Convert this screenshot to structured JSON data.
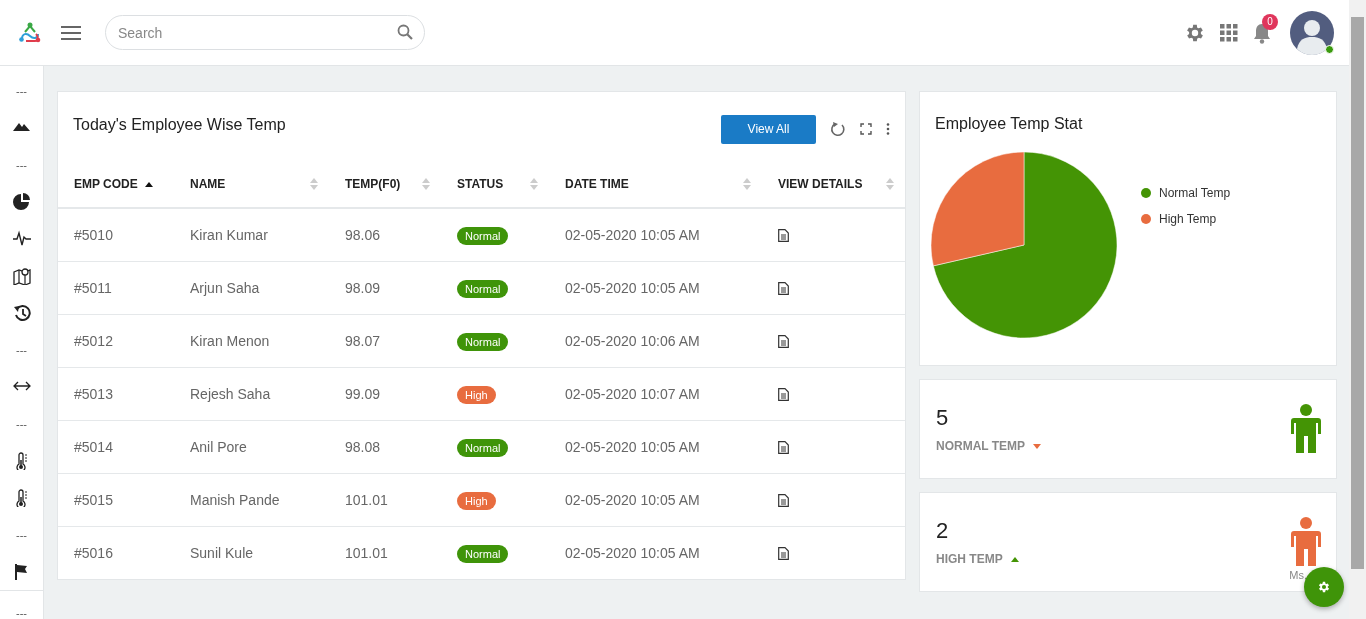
{
  "header": {
    "search": {
      "placeholder": "Search"
    },
    "notifications": {
      "count": "0"
    },
    "user": {
      "online": true
    }
  },
  "sidebar": {
    "items": [
      {
        "kind": "separator",
        "text": "---"
      },
      {
        "kind": "icon"
      },
      {
        "kind": "separator",
        "text": "---"
      },
      {
        "kind": "icon"
      },
      {
        "kind": "icon"
      },
      {
        "kind": "icon"
      },
      {
        "kind": "icon"
      },
      {
        "kind": "separator",
        "text": "---"
      },
      {
        "kind": "icon"
      },
      {
        "kind": "separator",
        "text": "---"
      },
      {
        "kind": "icon"
      },
      {
        "kind": "icon"
      },
      {
        "kind": "separator",
        "text": "---"
      },
      {
        "kind": "icon"
      }
    ],
    "footer": {
      "text": "---"
    }
  },
  "table_card": {
    "title": "Today's Employee Wise Temp",
    "button": "View All",
    "columns": [
      {
        "label": "EMP CODE",
        "sorted": true
      },
      {
        "label": "NAME",
        "sorted": false
      },
      {
        "label": "TEMP(F0)",
        "sorted": false
      },
      {
        "label": "STATUS",
        "sorted": false
      },
      {
        "label": "DATE TIME",
        "sorted": false
      },
      {
        "label": "VIEW DETAILS",
        "sorted": false
      }
    ],
    "rows": [
      {
        "code": "#5010",
        "name": "Kiran Kumar",
        "temp": "98.06",
        "status": {
          "text": "Normal",
          "color": "#3f9409"
        },
        "datetime": "02-05-2020 10:05 AM"
      },
      {
        "code": "#5011",
        "name": "Arjun Saha",
        "temp": "98.09",
        "status": {
          "text": "Normal",
          "color": "#3f9409"
        },
        "datetime": "02-05-2020 10:05 AM"
      },
      {
        "code": "#5012",
        "name": "Kiran Menon",
        "temp": "98.07",
        "status": {
          "text": "Normal",
          "color": "#3f9409"
        },
        "datetime": "02-05-2020 10:06 AM"
      },
      {
        "code": "#5013",
        "name": "Rejesh Saha",
        "temp": "99.09",
        "status": {
          "text": "High",
          "color": "#e86c3f"
        },
        "datetime": "02-05-2020 10:07 AM"
      },
      {
        "code": "#5014",
        "name": "Anil Pore",
        "temp": "98.08",
        "status": {
          "text": "Normal",
          "color": "#3f9409"
        },
        "datetime": "02-05-2020 10:05 AM"
      },
      {
        "code": "#5015",
        "name": "Manish Pande",
        "temp": "101.01",
        "status": {
          "text": "High",
          "color": "#e86c3f"
        },
        "datetime": "02-05-2020 10:05 AM"
      },
      {
        "code": "#5016",
        "name": "Sunil Kule",
        "temp": "101.01",
        "status": {
          "text": "Normal",
          "color": "#3f9409"
        },
        "datetime": "02-05-2020 10:05 AM"
      }
    ]
  },
  "pie_card": {
    "title": "Employee Temp Stat",
    "chart_data": {
      "type": "pie",
      "categories": [
        "Normal Temp",
        "High Temp"
      ],
      "values": [
        71.4,
        28.6
      ],
      "colors": [
        "#449405",
        "#e86c3f"
      ]
    }
  },
  "stat_cards": [
    {
      "value": "5",
      "label": "NORMAL TEMP",
      "trend_up": false,
      "color": "#449405"
    },
    {
      "value": "2",
      "label": "HIGH TEMP",
      "trend_up": true,
      "color": "#e86c3f",
      "caption": "Ms."
    }
  ]
}
